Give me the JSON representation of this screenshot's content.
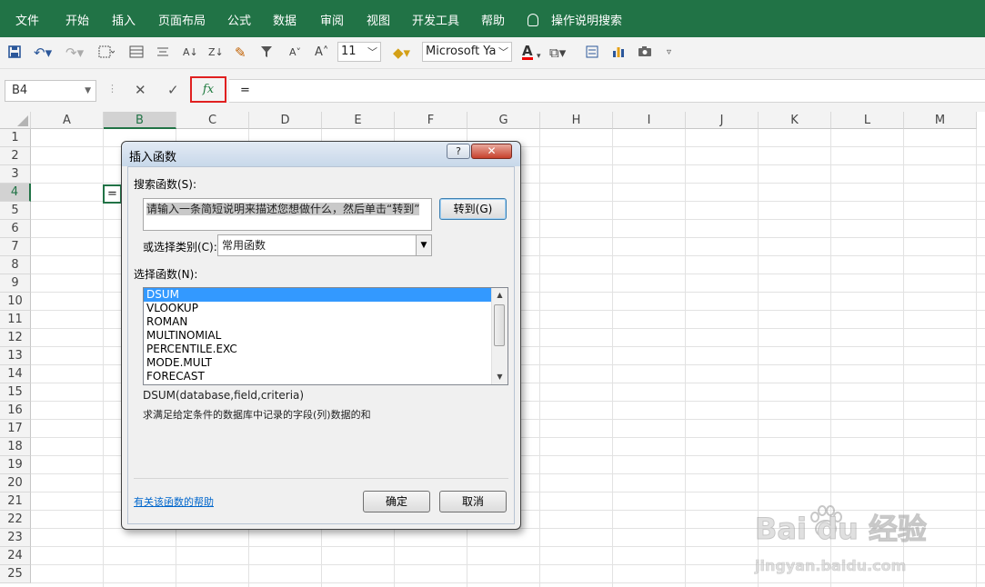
{
  "ribbon": {
    "tabs": [
      "文件",
      "开始",
      "插入",
      "页面布局",
      "公式",
      "数据",
      "审阅",
      "视图",
      "开发工具",
      "帮助"
    ],
    "tell_me": "操作说明搜索"
  },
  "toolbar": {
    "font_size": "11",
    "font_name": "Microsoft Ya"
  },
  "formula_bar": {
    "name_box": "B4",
    "cancel_icon": "close-icon",
    "enter_icon": "check-icon",
    "fx_label": "fx",
    "content": "="
  },
  "grid": {
    "columns": [
      "A",
      "B",
      "C",
      "D",
      "E",
      "F",
      "G",
      "H",
      "I",
      "J",
      "K",
      "L",
      "M"
    ],
    "rows": [
      "1",
      "2",
      "3",
      "4",
      "5",
      "6",
      "7",
      "8",
      "9",
      "10",
      "11",
      "12",
      "13",
      "14",
      "15",
      "16",
      "17",
      "18",
      "19",
      "20",
      "21",
      "22",
      "23",
      "24",
      "25"
    ],
    "active_cell_value": "="
  },
  "dialog": {
    "title": "插入函数",
    "help_button": "?",
    "close_button": "✕",
    "search_label": "搜索函数(S):",
    "search_value": "请输入一条简短说明来描述您想做什么，然后单击“转到”",
    "go_button": "转到(G)",
    "category_label": "或选择类别(C):",
    "category_value": "常用函数",
    "select_label": "选择函数(N):",
    "functions": [
      "DSUM",
      "VLOOKUP",
      "ROMAN",
      "MULTINOMIAL",
      "PERCENTILE.EXC",
      "MODE.MULT",
      "FORECAST"
    ],
    "selected_function": "DSUM",
    "signature": "DSUM(database,field,criteria)",
    "description": "求满足给定条件的数据库中记录的字段(列)数据的和",
    "help_link": "有关该函数的帮助",
    "ok_button": "确定",
    "cancel_button": "取消"
  },
  "watermark": {
    "line1": "Bai du 经验",
    "line2": "jingyan.baidu.com"
  },
  "colors": {
    "ribbon": "#217346",
    "selection": "#3399ff",
    "highlight_border": "#e02020"
  }
}
